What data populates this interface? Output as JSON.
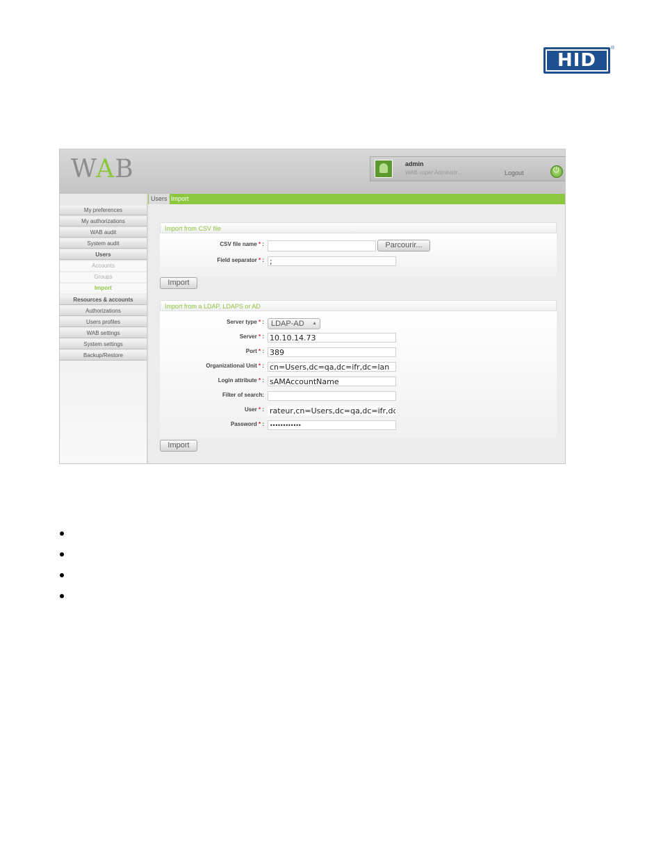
{
  "hid_logo": {
    "text": "HID",
    "reg": "®"
  },
  "app": {
    "logo": {
      "w": "W",
      "a": "A",
      "b": "B"
    },
    "user": {
      "name": "admin",
      "role": "WAB super Administr...",
      "logout": "Logout"
    },
    "breadcrumb": {
      "users": "Users",
      "import": "Import"
    },
    "sidebar": {
      "items": [
        "My preferences",
        "My authorizations",
        "WAB audit",
        "System audit",
        "Users"
      ],
      "sub_items": [
        "Accounts",
        "Groups",
        "Import"
      ],
      "items_after": [
        "Resources & accounts",
        "Authorizations",
        "Users profiles",
        "WAB settings",
        "System settings",
        "Backup/Restore"
      ]
    },
    "csv_panel": {
      "title": "Import from CSV file",
      "csv_label": "CSV file name",
      "csv_value": "",
      "browse_label": "Parcourir...",
      "sep_label": "Field separator",
      "sep_value": ";",
      "import_label": "Import"
    },
    "ldap_panel": {
      "title": "Import from a LDAP, LDAPS or AD",
      "server_type_label": "Server type",
      "server_type_value": "LDAP-AD",
      "server_label": "Server",
      "server_value": "10.10.14.73",
      "port_label": "Port",
      "port_value": "389",
      "ou_label": "Organizational Unit",
      "ou_value": "cn=Users,dc=qa,dc=ifr,dc=lan",
      "login_label": "Login attribute",
      "login_value": "sAMAccountName",
      "filter_label": "Filter of search:",
      "filter_value": "",
      "user_label": "User",
      "user_value": "rateur,cn=Users,dc=qa,dc=ifr,dc=lan",
      "password_label": "Password",
      "password_value": "••••••••••••",
      "import_label": "Import",
      "required_mark": "*",
      "colon": ":"
    }
  },
  "colors": {
    "accent": "#8dc63f",
    "brand": "#1d4f91"
  }
}
